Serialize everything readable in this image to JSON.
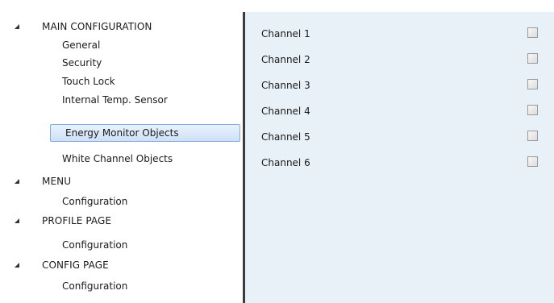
{
  "tree": {
    "groups": [
      {
        "label": "MAIN CONFIGURATION",
        "items": [
          {
            "label": "General"
          },
          {
            "label": "Security"
          },
          {
            "label": "Touch Lock"
          },
          {
            "label": "Internal Temp. Sensor"
          },
          {
            "label": "Energy Monitor Objects",
            "selected": true
          },
          {
            "label": "White Channel Objects"
          }
        ]
      },
      {
        "label": "MENU",
        "items": [
          {
            "label": "Configuration"
          }
        ]
      },
      {
        "label": "PROFILE PAGE",
        "items": [
          {
            "label": "Configuration"
          }
        ]
      },
      {
        "label": "CONFIG PAGE",
        "items": [
          {
            "label": "Configuration"
          }
        ]
      }
    ]
  },
  "channels": [
    {
      "label": "Channel 1",
      "checked": false
    },
    {
      "label": "Channel 2",
      "checked": false
    },
    {
      "label": "Channel 3",
      "checked": false
    },
    {
      "label": "Channel 4",
      "checked": false
    },
    {
      "label": "Channel 5",
      "checked": false
    },
    {
      "label": "Channel 6",
      "checked": false
    }
  ],
  "colors": {
    "selection_border": "#84acdd",
    "content_background": "#e9f1f8",
    "divider": "#3c3c3c"
  }
}
